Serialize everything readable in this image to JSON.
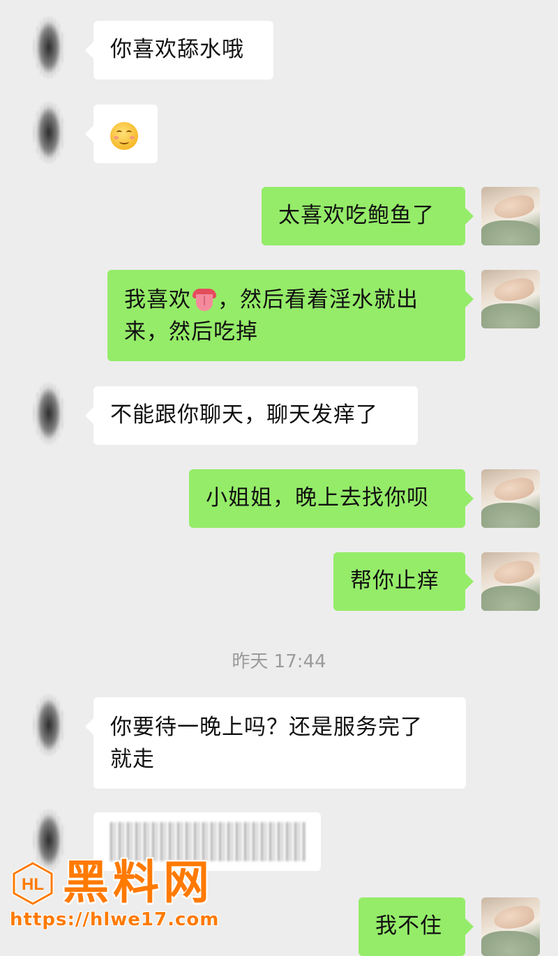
{
  "chat": {
    "messages": [
      {
        "side": "in",
        "text": "你喜欢舔水哦"
      },
      {
        "side": "in",
        "emoji": "smiling-face-emoji"
      },
      {
        "side": "out",
        "text": "太喜欢吃鲍鱼了"
      },
      {
        "side": "out",
        "text_before": "我喜欢",
        "emoji": "tongue-emoji",
        "text_line1_after": "，然后看着淫水就出",
        "text_line2": "来，然后吃掉"
      },
      {
        "side": "in",
        "text": "不能跟你聊天，聊天发痒了"
      },
      {
        "side": "out",
        "text": "小姐姐，晚上去找你呗"
      },
      {
        "side": "out",
        "text": "帮你止痒"
      },
      {
        "side": "in",
        "text_line1": "你要待一晚上吗？还是服务完了",
        "text_line2": "就走"
      },
      {
        "side": "in",
        "blurred": true
      },
      {
        "side": "out",
        "text": "我不住"
      }
    ],
    "timestamp": "昨天 17:44"
  },
  "watermark": {
    "title": "黑料网",
    "url": "https://hlwe17.com",
    "color": "#ff7a00"
  },
  "colors": {
    "background": "#ededed",
    "incoming_bubble": "#ffffff",
    "outgoing_bubble": "#95ec69",
    "timestamp": "#9b9b9b"
  }
}
